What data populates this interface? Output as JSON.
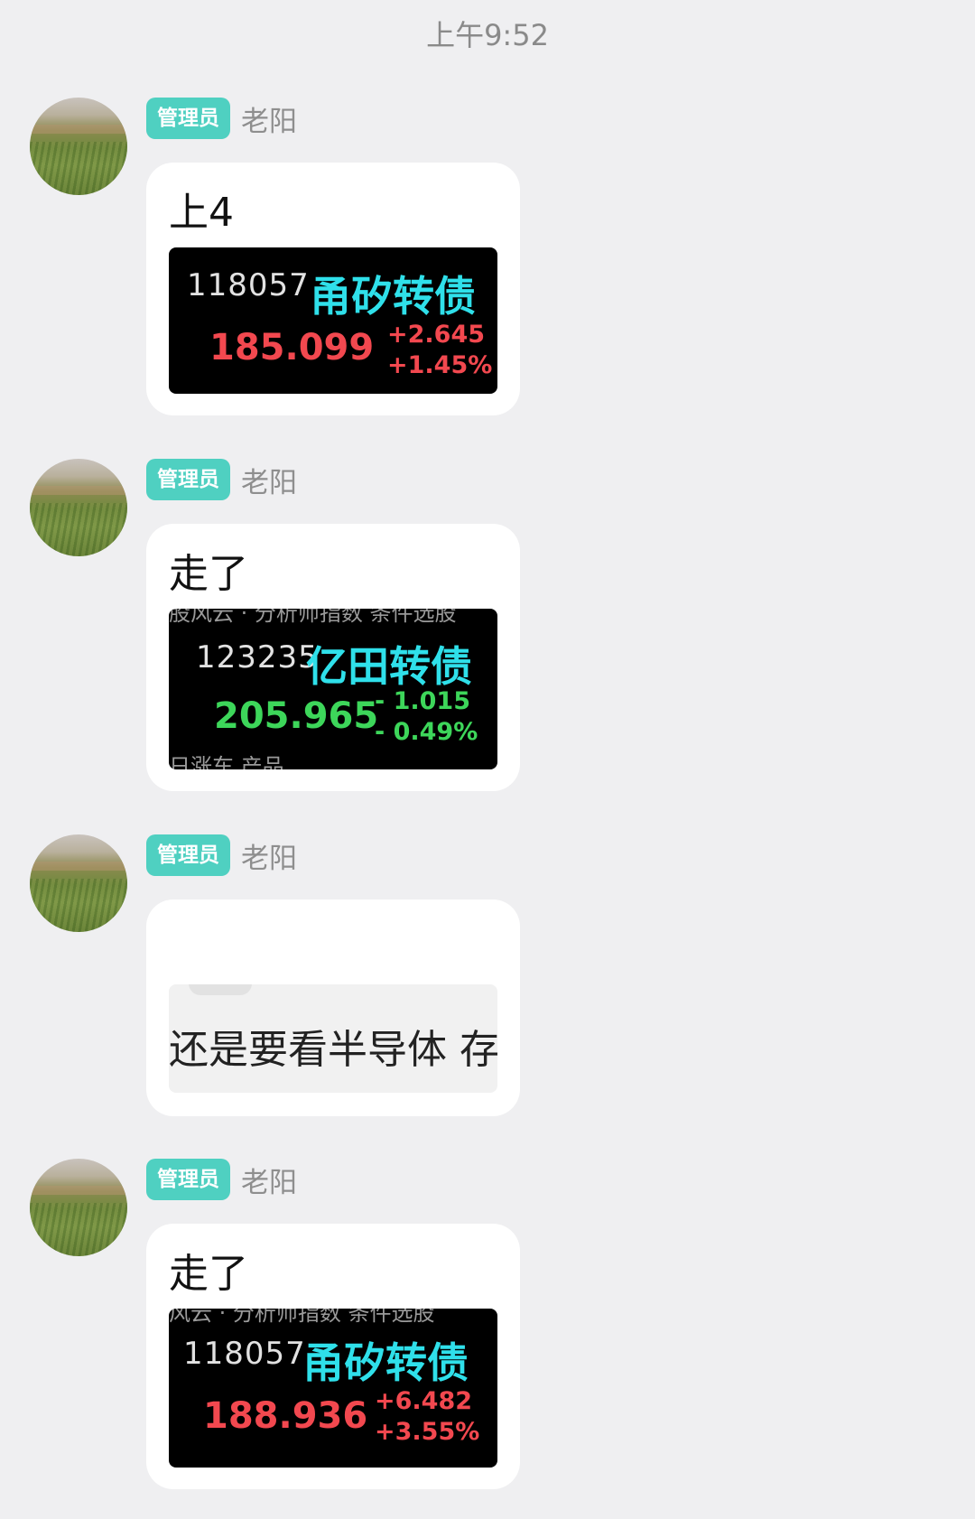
{
  "time_label": "上午9:52",
  "messages": [
    {
      "badge": "管理员",
      "sender": "老阳",
      "text": "上4",
      "quote": {
        "code": "118057",
        "name": "甬矽转债",
        "price": "185.099",
        "change": "+2.645",
        "change_pct": "+1.45%",
        "direction": "up"
      }
    },
    {
      "badge": "管理员",
      "sender": "老阳",
      "text": "走了",
      "quote": {
        "code": "123235",
        "name": "亿田转债",
        "price": "205.965",
        "change": "- 1.015",
        "change_pct": "- 0.49%",
        "direction": "down",
        "residue_top": "股风云 ·  分析师指数  条件选股",
        "residue_bottom": "日涨车                              产品"
      }
    },
    {
      "badge": "管理员",
      "sender": "老阳",
      "snippet": "还是要看半导体 存"
    },
    {
      "badge": "管理员",
      "sender": "老阳",
      "text": "走了",
      "quote": {
        "code": "118057",
        "name": "甬矽转债",
        "price": "188.936",
        "change": "+6.482",
        "change_pct": "+3.55%",
        "direction": "up",
        "residue_top": "风云 ·  分析师指数  条件选股"
      }
    }
  ],
  "colors": {
    "background": "#efeff1",
    "badge": "#4fd0c1",
    "quote_name": "#2fe0ea",
    "price_up": "#f2484f",
    "price_down": "#3dd65a"
  }
}
